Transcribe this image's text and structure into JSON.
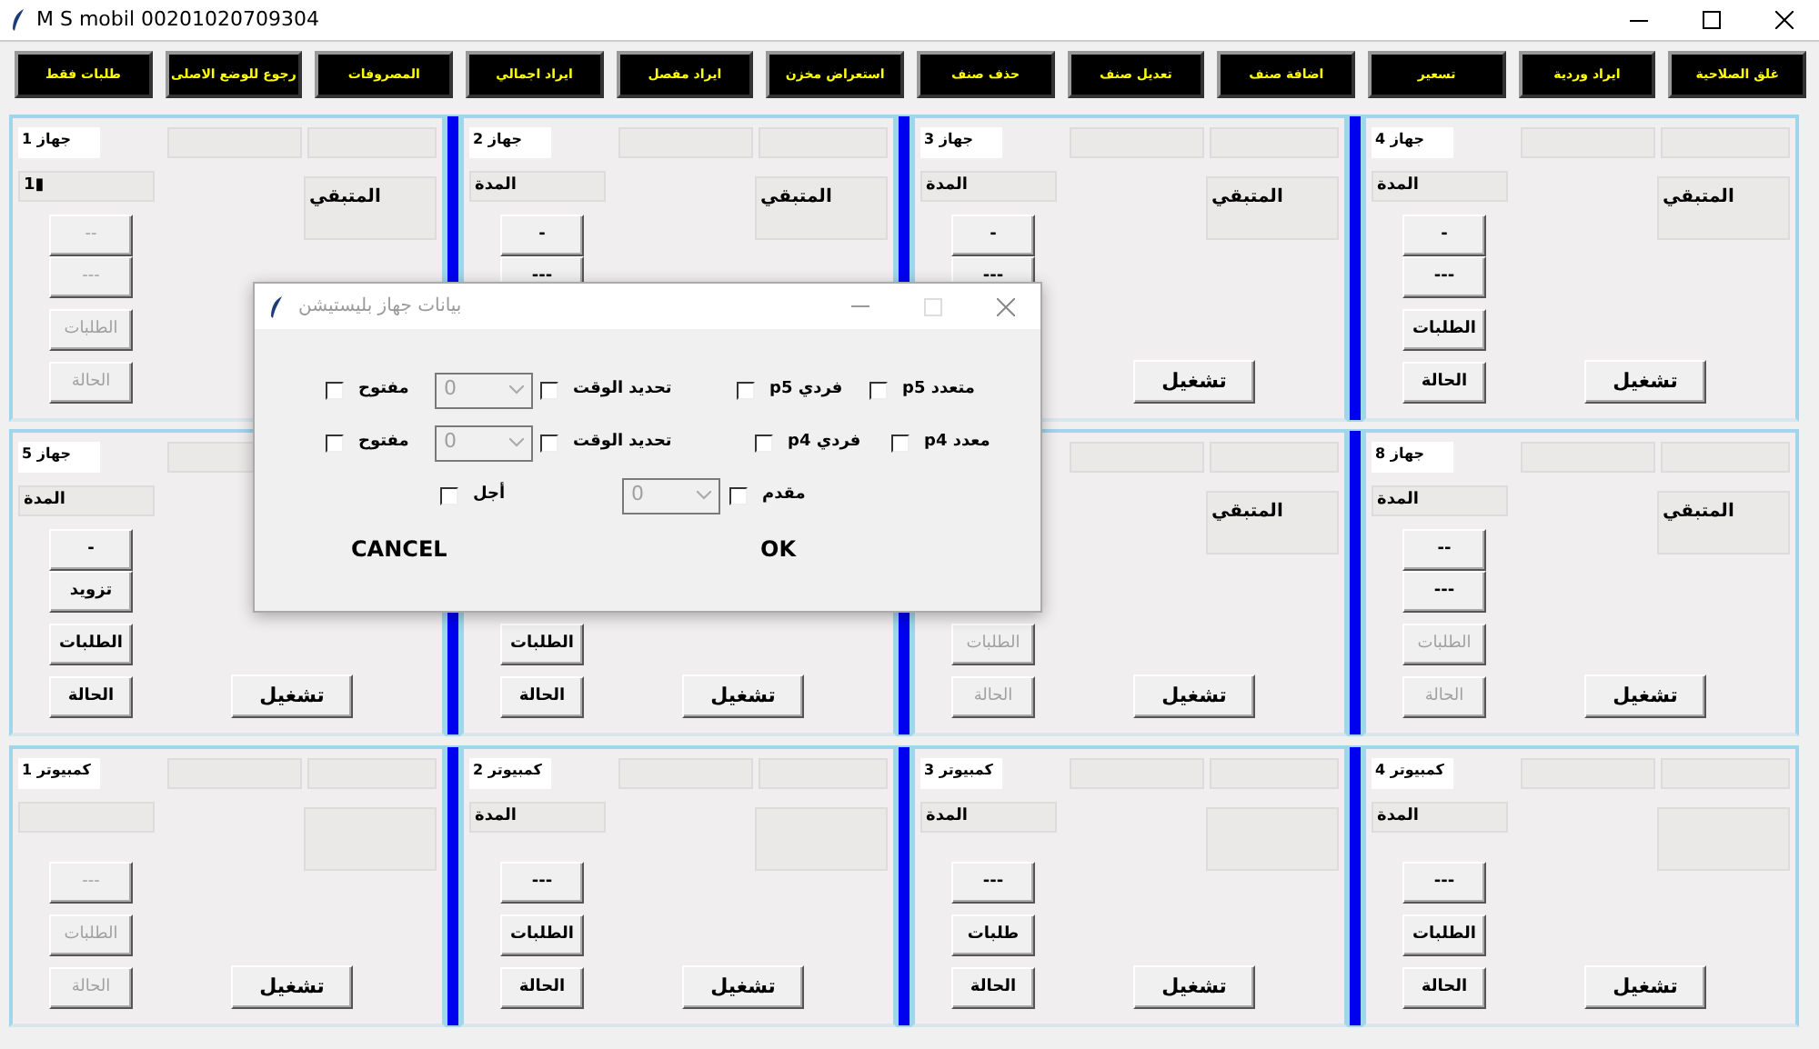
{
  "window": {
    "title": "M S mobil 00201020709304"
  },
  "toolbar": [
    "غلق الصلاحية",
    "ايراد وردية",
    "تسعير",
    "اضافة صنف",
    "تعديل صنف",
    "حذف صنف",
    "استعراض مخزن",
    "ايراد مفصل",
    "ايراد اجمالي",
    "المصروفات",
    "رجوع للوضع الاصلى",
    "طلبات فقط"
  ],
  "rows": [
    {
      "panels": [
        {
          "name": "جهاز 4",
          "duration": "المدة",
          "remaining": "المتبقي",
          "upper_buttons": [
            {
              "label": "-",
              "disabled": false
            },
            {
              "label": "---",
              "disabled": false
            }
          ],
          "lower_buttons": [
            {
              "label": "الطلبات",
              "disabled": false
            },
            {
              "label": "الحالة",
              "disabled": false
            }
          ],
          "run": {
            "label": "تشغيل"
          }
        },
        {
          "name": "جهاز 3",
          "duration": "المدة",
          "remaining": "المتبقي",
          "upper_buttons": [
            {
              "label": "-",
              "disabled": false
            },
            {
              "label": "---",
              "disabled": false
            }
          ],
          "run": {
            "label": "تشغيل"
          }
        },
        {
          "name": "جهاز 2",
          "duration": "المدة",
          "remaining": "المتبقي",
          "upper_buttons": [
            {
              "label": "-",
              "disabled": false
            },
            {
              "label": "---",
              "disabled": false
            }
          ]
        },
        {
          "name": "جهاز 1",
          "duration": "1▮",
          "remaining": "المتبقي",
          "upper_buttons": [
            {
              "label": "--",
              "disabled": true
            },
            {
              "label": "---",
              "disabled": true
            }
          ],
          "lower_buttons": [
            {
              "label": "الطلبات",
              "disabled": true
            },
            {
              "label": "الحالة",
              "disabled": true
            }
          ]
        }
      ]
    },
    {
      "panels": [
        {
          "name": "جهاز 8",
          "duration": "المدة",
          "remaining": "المتبقي",
          "upper_buttons": [
            {
              "label": "--",
              "disabled": false
            },
            {
              "label": "---",
              "disabled": false
            }
          ],
          "lower_buttons": [
            {
              "label": "الطلبات",
              "disabled": true
            },
            {
              "label": "الحالة",
              "disabled": true
            }
          ],
          "run": {
            "label": "تشغيل"
          }
        },
        {
          "remaining": "المتبقي",
          "lower_buttons": [
            {
              "label": "الطلبات",
              "disabled": true
            },
            {
              "label": "الحالة",
              "disabled": true
            }
          ],
          "run": {
            "label": "تشغيل"
          }
        },
        {
          "lower_buttons": [
            {
              "label": "الطلبات",
              "disabled": false
            },
            {
              "label": "الحالة",
              "disabled": false
            }
          ],
          "run": {
            "label": "تشغيل"
          }
        },
        {
          "name": "جهاز 5",
          "duration": "المدة",
          "upper_buttons": [
            {
              "label": "-",
              "disabled": false
            },
            {
              "label": "تزويد",
              "disabled": false
            }
          ],
          "lower_buttons": [
            {
              "label": "الطلبات",
              "disabled": false
            },
            {
              "label": "الحالة",
              "disabled": false
            }
          ],
          "run": {
            "label": "تشغيل"
          }
        }
      ]
    },
    {
      "panels": [
        {
          "name": "كمبيوتر 4",
          "duration": "المدة",
          "upper_buttons": [
            {
              "label": "---",
              "disabled": false
            }
          ],
          "lower_buttons": [
            {
              "label": "الطلبات",
              "disabled": false
            },
            {
              "label": "الحالة",
              "disabled": false
            }
          ],
          "run": {
            "label": "تشغيل"
          }
        },
        {
          "name": "كمبيوتر 3",
          "duration": "المدة",
          "upper_buttons": [
            {
              "label": "---",
              "disabled": false
            }
          ],
          "lower_buttons": [
            {
              "label": "طلبات",
              "disabled": false
            },
            {
              "label": "الحالة",
              "disabled": false
            }
          ],
          "run": {
            "label": "تشغيل"
          }
        },
        {
          "name": "كمبيوتر 2",
          "duration": "المدة",
          "upper_buttons": [
            {
              "label": "---",
              "disabled": false
            }
          ],
          "lower_buttons": [
            {
              "label": "الطلبات",
              "disabled": false
            },
            {
              "label": "الحالة",
              "disabled": false
            }
          ],
          "run": {
            "label": "تشغيل"
          }
        },
        {
          "name": "كمبيوتر 1",
          "upper_buttons": [
            {
              "label": "---",
              "disabled": true
            }
          ],
          "lower_buttons": [
            {
              "label": "الطلبات",
              "disabled": true
            },
            {
              "label": "الحالة",
              "disabled": true
            }
          ],
          "run": {
            "label": "تشغيل"
          }
        }
      ]
    }
  ],
  "dialog": {
    "title": "بيانات جهاز بليستيشن",
    "rows": [
      {
        "items": [
          {
            "kind": "check",
            "label": "p5 متعدد",
            "checked": false
          },
          {
            "kind": "check",
            "label": "p5 فردي",
            "checked": false
          },
          {
            "kind": "check",
            "label": "تحديد الوقت",
            "checked": false
          },
          {
            "kind": "combo",
            "value": "0",
            "disabled": true
          },
          {
            "kind": "check",
            "label": "مفتوح",
            "checked": false
          }
        ]
      },
      {
        "items": [
          {
            "kind": "check",
            "label": "p4 معدد",
            "checked": false
          },
          {
            "kind": "check",
            "label": "p4 فردي",
            "checked": false
          },
          {
            "kind": "check",
            "label": "تحديد الوقت",
            "checked": false
          },
          {
            "kind": "combo",
            "value": "0",
            "disabled": true
          },
          {
            "kind": "check",
            "label": "مفتوح",
            "checked": false
          }
        ]
      },
      {
        "items": [
          {
            "kind": "check",
            "label": "مقدم",
            "checked": false
          },
          {
            "kind": "combo",
            "value": "0",
            "disabled": true
          },
          {
            "kind": "check",
            "label": "أجل",
            "checked": false
          }
        ]
      }
    ],
    "buttons": [
      "OK",
      "CANCEL"
    ]
  }
}
